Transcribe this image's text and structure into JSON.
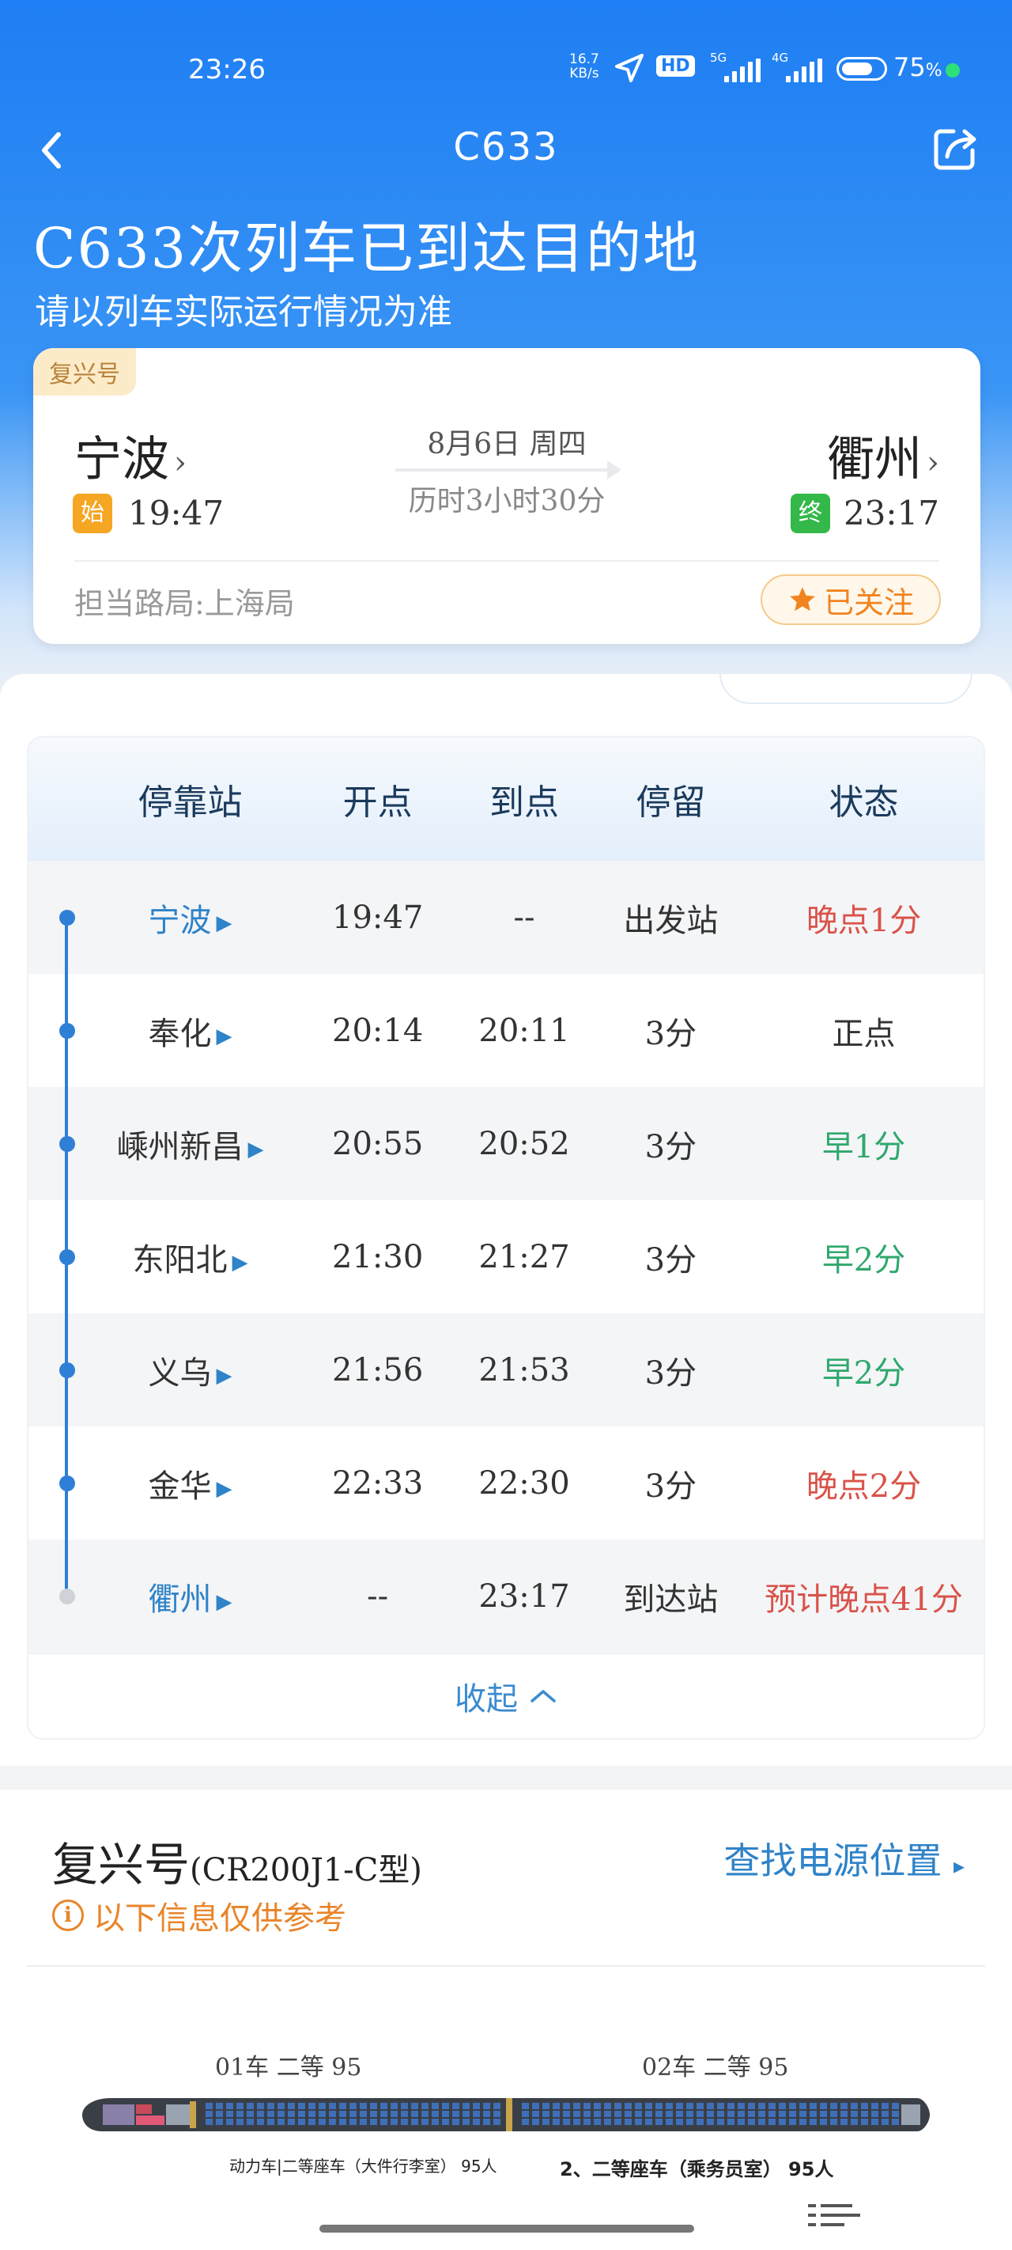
{
  "status_bar": {
    "time": "23:26",
    "net_speed_value": "16.7",
    "net_speed_unit": "KB/s",
    "hd_badge": "HD",
    "sig1": "5G",
    "sig2": "4G",
    "battery_pct": "75",
    "battery_unit": "%",
    "battery_level": 0.75
  },
  "nav": {
    "title": "C633"
  },
  "header": {
    "headline": "C633次列车已到达目的地",
    "subline": "请以列车实际运行情况为准"
  },
  "trip": {
    "train_type": "复兴号",
    "from_station": "宁波",
    "to_station": "衢州",
    "date": "8月6日 周四",
    "duration": "历时3小时30分",
    "start_badge": "始",
    "end_badge": "终",
    "depart_time": "19:47",
    "arrive_time": "23:17",
    "bureau": "担当路局:上海局",
    "follow_label": "已关注"
  },
  "stops_table": {
    "headers": [
      "停靠站",
      "开点",
      "到点",
      "停留",
      "状态"
    ],
    "rows": [
      {
        "station": "宁波",
        "depart": "19:47",
        "arrive": "--",
        "stay": "出发站",
        "status": "晚点1分",
        "status_kind": "late",
        "highlight": true
      },
      {
        "station": "奉化",
        "depart": "20:14",
        "arrive": "20:11",
        "stay": "3分",
        "status": "正点",
        "status_kind": "ontime",
        "highlight": false
      },
      {
        "station": "嵊州新昌",
        "depart": "20:55",
        "arrive": "20:52",
        "stay": "3分",
        "status": "早1分",
        "status_kind": "early",
        "highlight": false
      },
      {
        "station": "东阳北",
        "depart": "21:30",
        "arrive": "21:27",
        "stay": "3分",
        "status": "早2分",
        "status_kind": "early",
        "highlight": false
      },
      {
        "station": "义乌",
        "depart": "21:56",
        "arrive": "21:53",
        "stay": "3分",
        "status": "早2分",
        "status_kind": "early",
        "highlight": false
      },
      {
        "station": "金华",
        "depart": "22:33",
        "arrive": "22:30",
        "stay": "3分",
        "status": "晚点2分",
        "status_kind": "late",
        "highlight": false
      },
      {
        "station": "衢州",
        "depart": "--",
        "arrive": "23:17",
        "stay": "到达站",
        "status": "预计晚点41分",
        "status_kind": "late",
        "highlight": true
      }
    ],
    "collapse_label": "收起"
  },
  "train_model": {
    "name": "复兴号",
    "model": "(CR200J1-C型)",
    "power_link": "查找电源位置",
    "notice": "以下信息仅供参考",
    "notice_icon": "i",
    "cars": [
      {
        "label": "01车 二等 95",
        "caption": "动力车|二等座车（大件行李室） 95人"
      },
      {
        "label": "02车 二等 95",
        "caption": "2、二等座车（乘务员室） 95人"
      }
    ]
  },
  "colors": {
    "brand_blue": "#1e7ef3",
    "late_red": "#d9534a",
    "early_green": "#2fa86d",
    "follow_orange": "#f2841f"
  },
  "icons": {
    "back": "chevron-left-icon",
    "share": "share-icon",
    "star": "star-icon",
    "expand": "chevron-up-icon",
    "info": "info-icon"
  }
}
